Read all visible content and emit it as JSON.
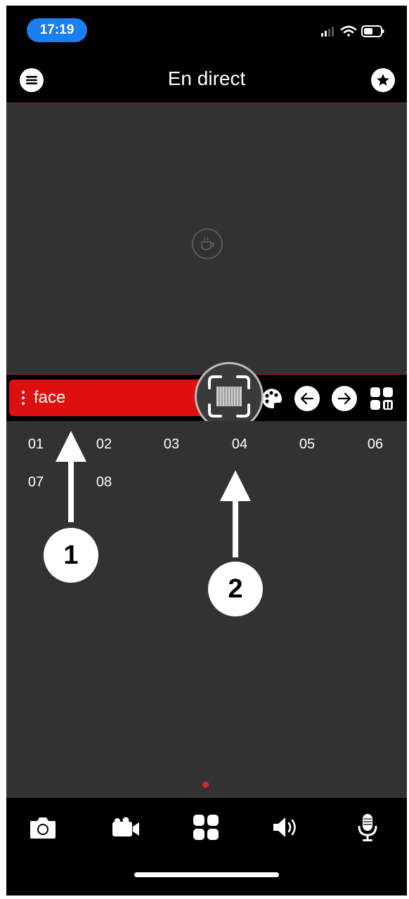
{
  "status_bar": {
    "time": "17:19"
  },
  "header": {
    "title": "En direct",
    "menu_icon": "menu-icon",
    "favorites_icon": "star-icon"
  },
  "toolbar": {
    "group_label": "face",
    "buttons": [
      "fullscreen-icon",
      "palette-icon",
      "arrow-left-icon",
      "arrow-right-icon",
      "layout-grid-icon"
    ]
  },
  "channels": [
    "01",
    "02",
    "03",
    "04",
    "05",
    "06",
    "07",
    "08"
  ],
  "annotations": {
    "badge_1": "1",
    "badge_2": "2"
  },
  "bottom_bar": {
    "icons": [
      "camera-icon",
      "video-camera-icon",
      "grid-view-icon",
      "speaker-icon",
      "microphone-icon"
    ]
  },
  "colors": {
    "accent_red": "#e00f0f",
    "status_blue": "#1a7ff0",
    "panel_gray": "#323234"
  },
  "page_indicator": {
    "current": 1,
    "total": 1
  }
}
